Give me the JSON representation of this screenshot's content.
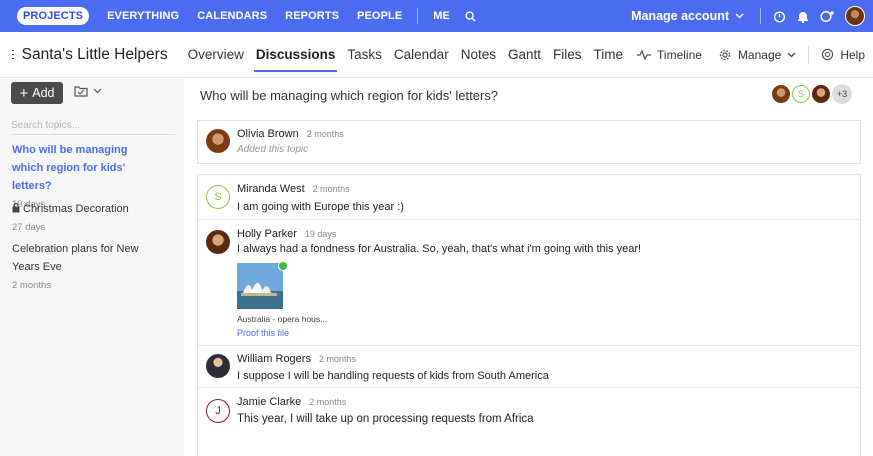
{
  "topnav": {
    "items": [
      {
        "label": "PROJECTS",
        "active": true
      },
      {
        "label": "EVERYTHING"
      },
      {
        "label": "CALENDARS"
      },
      {
        "label": "REPORTS"
      },
      {
        "label": "PEOPLE"
      },
      {
        "label": "ME"
      }
    ],
    "account_label": "Manage account",
    "color": "#4a6cf0"
  },
  "header": {
    "project_title": "Santa's Little Helpers",
    "tabs": [
      {
        "label": "Overview"
      },
      {
        "label": "Discussions",
        "active": true
      },
      {
        "label": "Tasks"
      },
      {
        "label": "Calendar"
      },
      {
        "label": "Notes"
      },
      {
        "label": "Gantt"
      },
      {
        "label": "Files"
      },
      {
        "label": "Time"
      }
    ],
    "timeline_label": "Timeline",
    "manage_label": "Manage",
    "help_label": "Help"
  },
  "sidebar": {
    "add_label": "Add",
    "search_placeholder": "Search topics...",
    "topics": [
      {
        "title": "Who will be managing which region for kids' letters?",
        "age": "19 days",
        "active": true
      },
      {
        "title": "Christmas Decoration",
        "age": "27 days",
        "locked": true
      },
      {
        "title": "Celebration plans for New Years Eve",
        "age": "2 months"
      }
    ]
  },
  "main": {
    "title": "Who will be managing which region for kids' letters?",
    "participants_more": "+3",
    "participant_letter": "S",
    "op": {
      "author": "Olivia Brown",
      "age": "2 months",
      "text": "Added this topic"
    },
    "posts": [
      {
        "author": "Miranda West",
        "age": "2 months",
        "text": "I am going with Europe this year :)",
        "avatar_letter": "S",
        "avatar_color": "#8cc63f"
      },
      {
        "author": "Holly Parker",
        "age": "19 days",
        "text": "I always had a fondness for Australia. So, yeah, that's what i'm going with this year!",
        "attachment_name": "Australia - opera hous...",
        "attachment_action": "Proof this file"
      },
      {
        "author": "William Rogers",
        "age": "2 months",
        "text": "I suppose I will be handling requests of kids from South America"
      },
      {
        "author": "Jamie Clarke",
        "age": "2 months",
        "text": "This year, I will take up on processing requests from Africa",
        "avatar_letter": "J",
        "avatar_color": "#8b1a1a"
      }
    ]
  }
}
